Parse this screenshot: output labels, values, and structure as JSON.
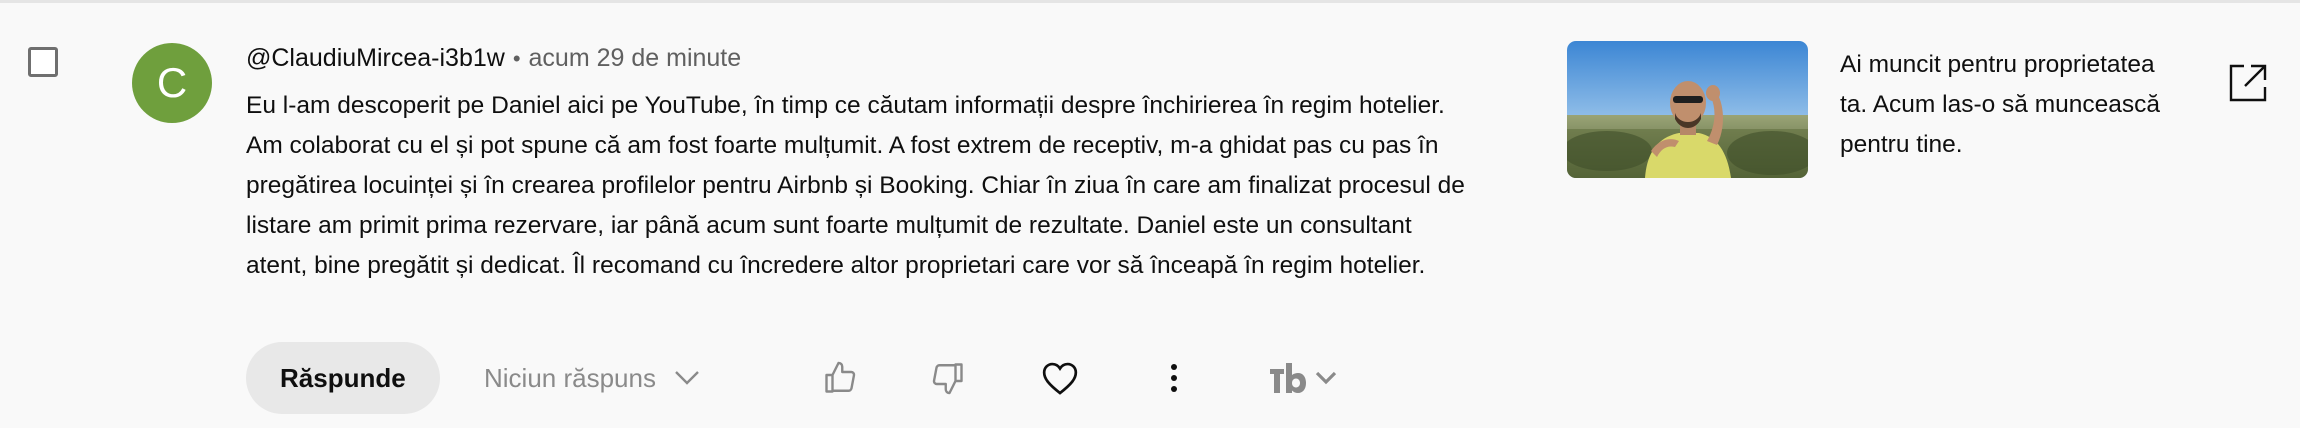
{
  "comment": {
    "avatar_letter": "C",
    "avatar_color": "#6f9f3d",
    "author": "@ClaudiuMircea-i3b1w",
    "separator": "•",
    "time": "acum 29 de minute",
    "text": "Eu l-am descoperit pe Daniel aici pe YouTube, în timp ce căutam informații despre închirierea în regim hotelier. Am colaborat cu el și pot spune că am fost foarte mulțumit. A fost extrem de receptiv, m-a ghidat pas cu pas în pregătirea locuinței și în crearea profilelor pentru Airbnb și Booking. Chiar în ziua în care am finalizat procesul de listare am primit prima rezervare, iar până acum sunt foarte mulțumit de rezultate. Daniel este un consultant atent, bine pregătit și dedicat. Îl recomand cu încredere altor proprietari care vor să înceapă în regim hotelier."
  },
  "actions": {
    "reply_label": "Răspunde",
    "replies_label": "Niciun răspuns",
    "icons": [
      "thumbs-up-icon",
      "thumbs-down-icon",
      "heart-icon",
      "more-vert-icon",
      "tubebuddy-icon",
      "chevron-down-icon"
    ]
  },
  "video": {
    "title": "Ai muncit pentru proprietatea ta. Acum las-o să muncească pentru tine."
  }
}
